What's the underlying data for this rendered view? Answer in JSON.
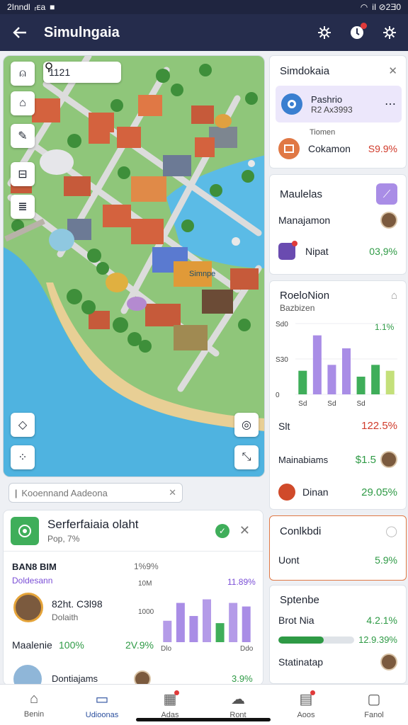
{
  "status": {
    "time": "2Inndl",
    "carrier": "ᵣᴇa",
    "right": "iI ⊘2Ǝ0"
  },
  "appbar": {
    "title": "Simulngaia"
  },
  "map": {
    "coord": "1121",
    "label": "Simnpe"
  },
  "search": {
    "placeholder": "Kooennand Aadeona"
  },
  "bottom_card": {
    "title": "Serferfaiaia olaht",
    "subtitle": "Pop, 7%",
    "section": "BAN8 BIM",
    "section_pct": "1%9%",
    "subsection": "Doldesann",
    "person_value": "82ht. C3l98",
    "person_role": "Dolaith",
    "mini_y1": "10M",
    "mini_y2": "1000",
    "mini_badge": "11.89%",
    "row1_label": "Maalenie",
    "row1_pct": "100%",
    "row1_val": "2V.9%",
    "row2_label": "Dontiajams",
    "row2_pct": "3.9%",
    "x_left": "Dlo",
    "x_right": "Ddo",
    "bars": [
      0.36,
      0.66,
      0.44,
      0.72,
      0.32,
      0.66,
      0.6
    ],
    "bar_colors": [
      "#b49be8",
      "#a98de6",
      "#a98de6",
      "#b49be8",
      "#3fae5a",
      "#b49be8",
      "#a98de6"
    ]
  },
  "panel_top": {
    "title": "Simdokaia",
    "item1_title": "Pashrio",
    "item1_sub": "R2 Ax3993",
    "item2_label": "Tiomen",
    "item2_title": "Cokamon",
    "item2_value": "S9.9%"
  },
  "panel_maul": {
    "title": "Maulelas",
    "row1": "Manajamon",
    "row2": "Nipat",
    "row2_value": "03,9%"
  },
  "panel_chart": {
    "title": "RoeloNion",
    "subtitle": "Bazbizen",
    "badge": "1.1%",
    "row1": "Slt",
    "row1_value": "122.5%",
    "row2": "Mainabiams",
    "row2_value": "$1.5",
    "row3": "Dinan",
    "row3_value": "29.05%"
  },
  "chart_data": {
    "type": "bar",
    "categories": [
      "Sd",
      "",
      "Sd",
      "",
      "Sd",
      "",
      ""
    ],
    "values": [
      40,
      100,
      50,
      78,
      30,
      50,
      40
    ],
    "colors": [
      "#3fae5a",
      "#a98de6",
      "#a98de6",
      "#a98de6",
      "#3fae5a",
      "#3fae5a",
      "#c4e07a"
    ],
    "y_ticks": [
      "Sd0",
      "S30",
      "0"
    ],
    "ylim": [
      0,
      120
    ],
    "xlabel": "",
    "ylabel": ""
  },
  "panel_conf": {
    "title": "Conlkbdi",
    "row": "Uont",
    "row_value": "5.9%"
  },
  "panel_sp": {
    "title": "Sptenbe",
    "row1": "Brot Nia",
    "row1_value": "4.2.1%",
    "progress": 0.6,
    "progress_value": "12.9.39%",
    "row2": "Statinatap"
  },
  "nav": [
    {
      "label": "Benin",
      "icon": "home-icon",
      "active": false
    },
    {
      "label": "Udioonas",
      "icon": "monitor-icon",
      "active": true
    },
    {
      "label": "Adas",
      "icon": "calendar-icon",
      "active": false
    },
    {
      "label": "Ront",
      "icon": "cloud-icon",
      "active": false
    },
    {
      "label": "Aoos",
      "icon": "inbox-icon",
      "active": false
    },
    {
      "label": "Fanol",
      "icon": "panel-icon",
      "active": false
    }
  ],
  "colors": {
    "accent": "#252c4c",
    "green": "#3fae5a",
    "purple": "#a98de6",
    "red": "#d03a2a"
  }
}
